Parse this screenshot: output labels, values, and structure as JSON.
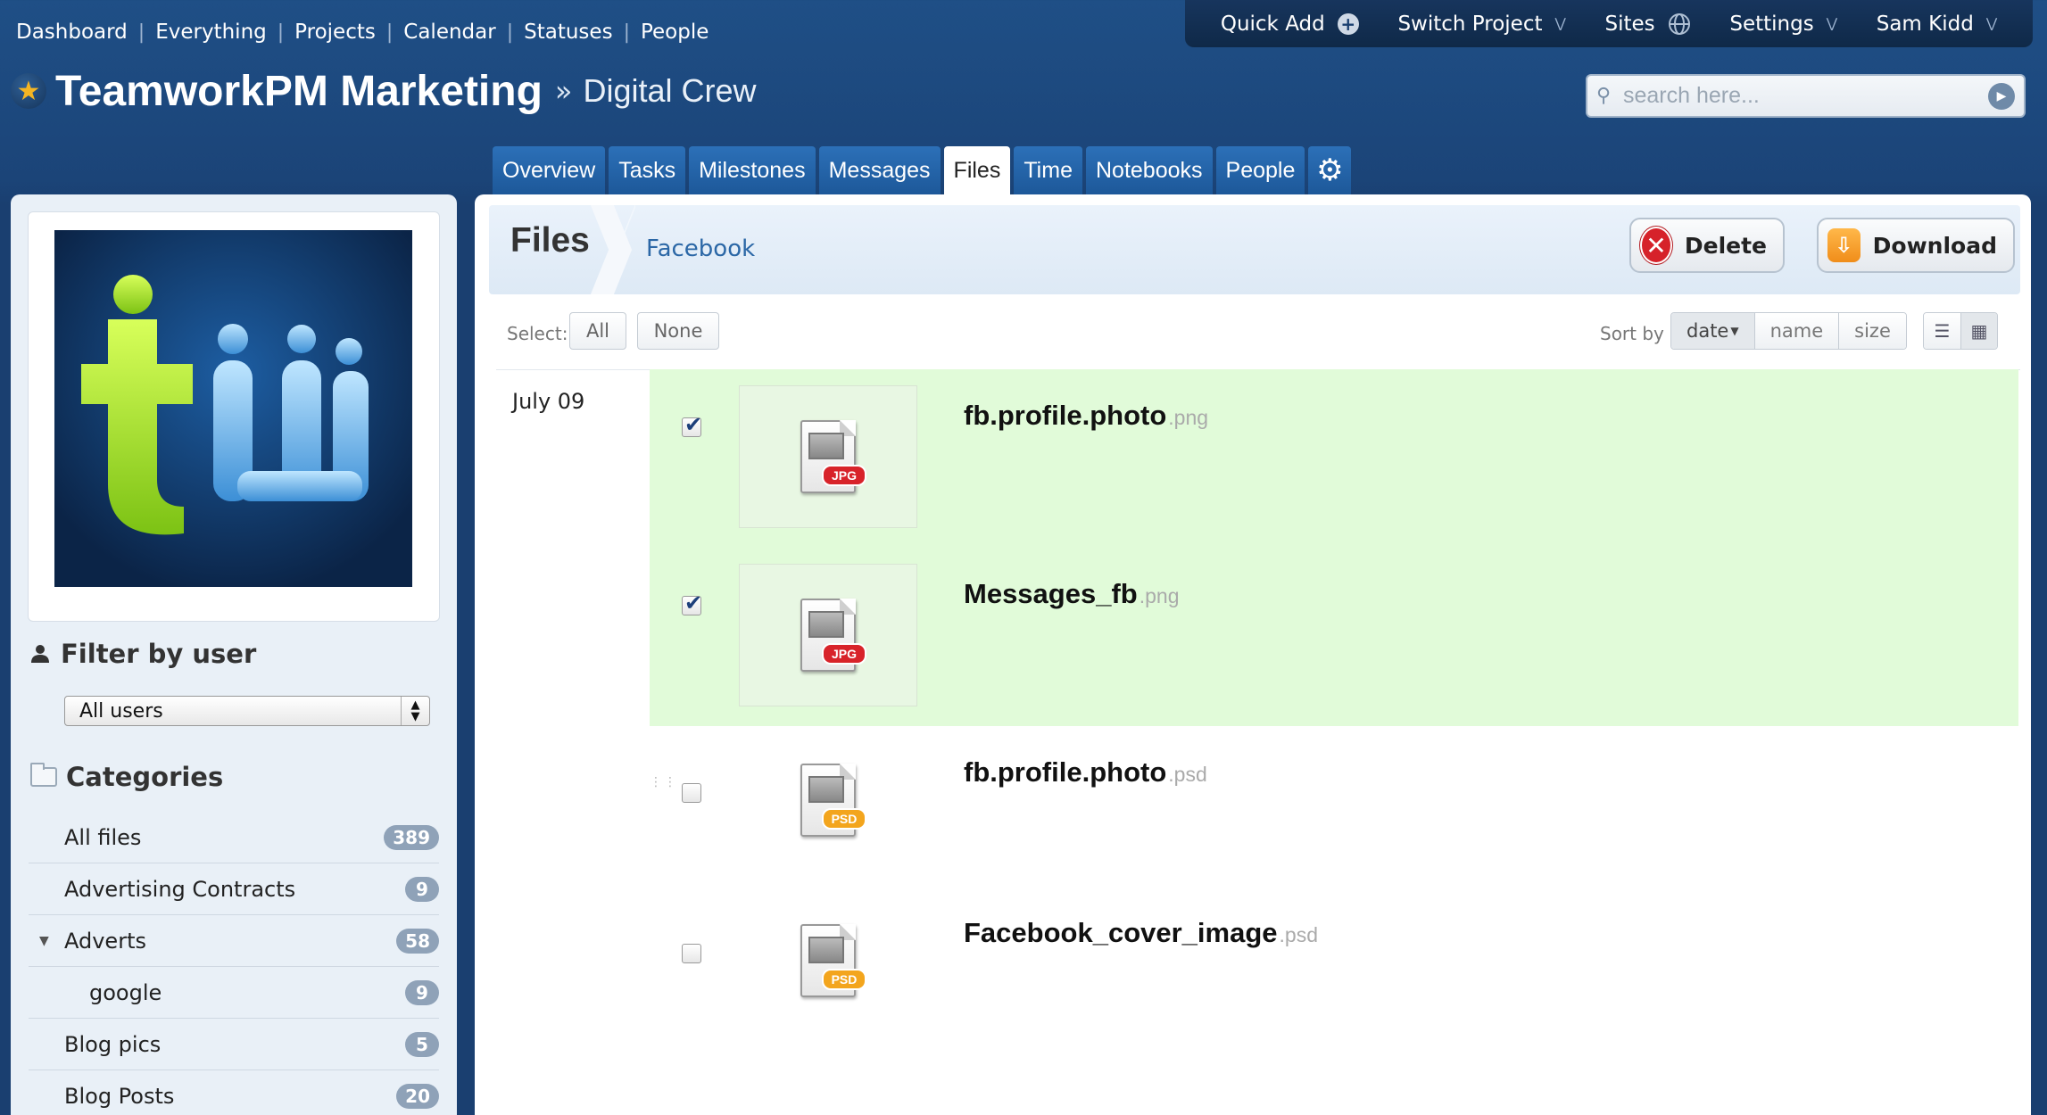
{
  "nav": {
    "links": [
      "Dashboard",
      "Everything",
      "Projects",
      "Calendar",
      "Statuses",
      "People"
    ],
    "separator": "|"
  },
  "topbar": {
    "quick_add": "Quick Add",
    "switch_project": "Switch Project",
    "sites": "Sites",
    "settings": "Settings",
    "user": "Sam Kidd"
  },
  "header": {
    "project": "TeamworkPM Marketing",
    "separator": "»",
    "company": "Digital Crew"
  },
  "search": {
    "placeholder": "search here..."
  },
  "tabs": [
    {
      "label": "Overview"
    },
    {
      "label": "Tasks"
    },
    {
      "label": "Milestones"
    },
    {
      "label": "Messages"
    },
    {
      "label": "Files",
      "active": true
    },
    {
      "label": "Time"
    },
    {
      "label": "Notebooks"
    },
    {
      "label": "People"
    }
  ],
  "sidebar": {
    "filter_heading": "Filter by user",
    "user_select": "All users",
    "categories_heading": "Categories",
    "categories": [
      {
        "label": "All files",
        "count": "389"
      },
      {
        "label": "Advertising Contracts",
        "count": "9"
      },
      {
        "label": "Adverts",
        "count": "58",
        "expanded": true
      },
      {
        "label": "google",
        "count": "9",
        "child": true
      },
      {
        "label": "Blog pics",
        "count": "5"
      },
      {
        "label": "Blog Posts",
        "count": "20"
      }
    ]
  },
  "files": {
    "title": "Files",
    "breadcrumb": "Facebook",
    "delete_label": "Delete",
    "download_label": "Download",
    "select_label": "Select:",
    "select_all": "All",
    "select_none": "None",
    "sort_label": "Sort by",
    "sort_options": [
      "date",
      "name",
      "size"
    ],
    "date_group": "July 09",
    "items": [
      {
        "name": "fb.profile.photo",
        "ext": ".png",
        "badge": "JPG",
        "checked": true
      },
      {
        "name": "Messages_fb",
        "ext": ".png",
        "badge": "JPG",
        "checked": true
      },
      {
        "name": "fb.profile.photo",
        "ext": ".psd",
        "badge": "PSD",
        "checked": false
      },
      {
        "name": "Facebook_cover_image",
        "ext": ".psd",
        "badge": "PSD",
        "checked": false
      }
    ]
  },
  "colors": {
    "header_bg": "#1b4478",
    "tab_bg": "#2466ad",
    "selected_row": "#e1fbd9",
    "badge_bg": "#8fa2b8",
    "delete_red": "#d6222a",
    "download_orange": "#f39a20"
  },
  "icons": {
    "star": "star-icon",
    "quick_add": "plus-circle-icon",
    "sites": "globe-icon",
    "tab_settings": "gear-icon",
    "filter": "user-icon",
    "categories": "folder-icon"
  }
}
